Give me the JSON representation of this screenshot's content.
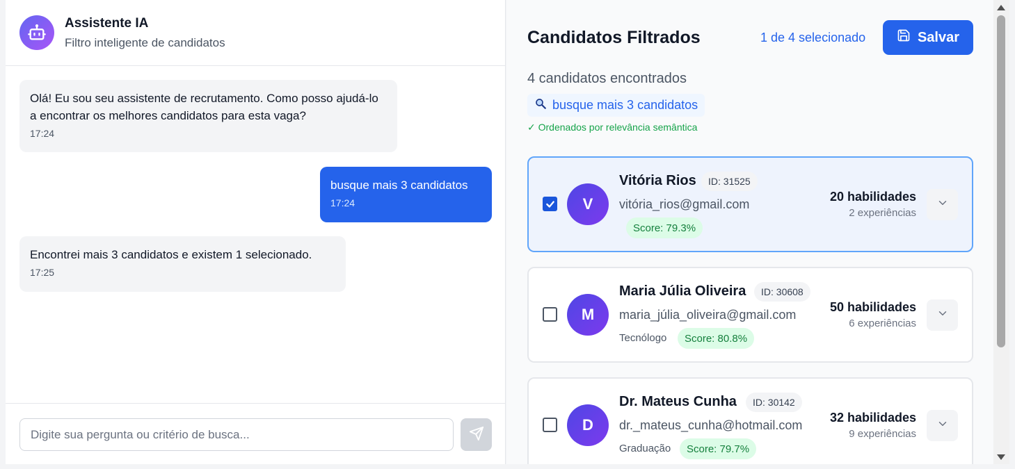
{
  "chat": {
    "title": "Assistente IA",
    "subtitle": "Filtro inteligente de candidatos",
    "messages": [
      {
        "role": "assistant",
        "text": "Olá! Eu sou seu assistente de recrutamento. Como posso ajudá-lo a encontrar os melhores candidatos para esta vaga?",
        "time": "17:24"
      },
      {
        "role": "user",
        "text": "busque mais 3 candidatos",
        "time": "17:24"
      },
      {
        "role": "assistant",
        "text": "Encontrei mais 3 candidatos e existem 1 selecionado.",
        "time": "17:25"
      }
    ],
    "input_placeholder": "Digite sua pergunta ou critério de busca...",
    "input_value": ""
  },
  "results": {
    "title": "Candidatos Filtrados",
    "selected_count": "1 de 4 selecionado",
    "save_label": "Salvar",
    "found_text": "4 candidatos encontrados",
    "query_chip": "busque mais 3 candidatos",
    "ordered_note": "✓ Ordenados por relevância semântica",
    "candidates": [
      {
        "initial": "V",
        "name": "Vitória Rios",
        "id": "ID: 31525",
        "email": "vitória_rios@gmail.com",
        "degree": "",
        "score": "Score: 79.3%",
        "skills": "20 habilidades",
        "experiences": "2 experiências",
        "selected": true
      },
      {
        "initial": "M",
        "name": "Maria Júlia Oliveira",
        "id": "ID: 30608",
        "email": "maria_júlia_oliveira@gmail.com",
        "degree": "Tecnólogo",
        "score": "Score: 80.8%",
        "skills": "50 habilidades",
        "experiences": "6 experiências",
        "selected": false
      },
      {
        "initial": "D",
        "name": "Dr. Mateus Cunha",
        "id": "ID: 30142",
        "email": "dr._mateus_cunha@hotmail.com",
        "degree": "Graduação",
        "score": "Score: 79.7%",
        "skills": "32 habilidades",
        "experiences": "9 experiências",
        "selected": false
      }
    ]
  },
  "icons": {
    "bot": "robot-icon",
    "send": "send-icon",
    "save": "save-icon",
    "query": "search-icon",
    "expand": "chevron-down-icon"
  },
  "colors": {
    "primary": "#2563eb",
    "success": "#16a34a",
    "score_bg": "#dcfce7",
    "avatar_gradient_start": "#4f46e5",
    "avatar_gradient_end": "#7c3aed"
  }
}
